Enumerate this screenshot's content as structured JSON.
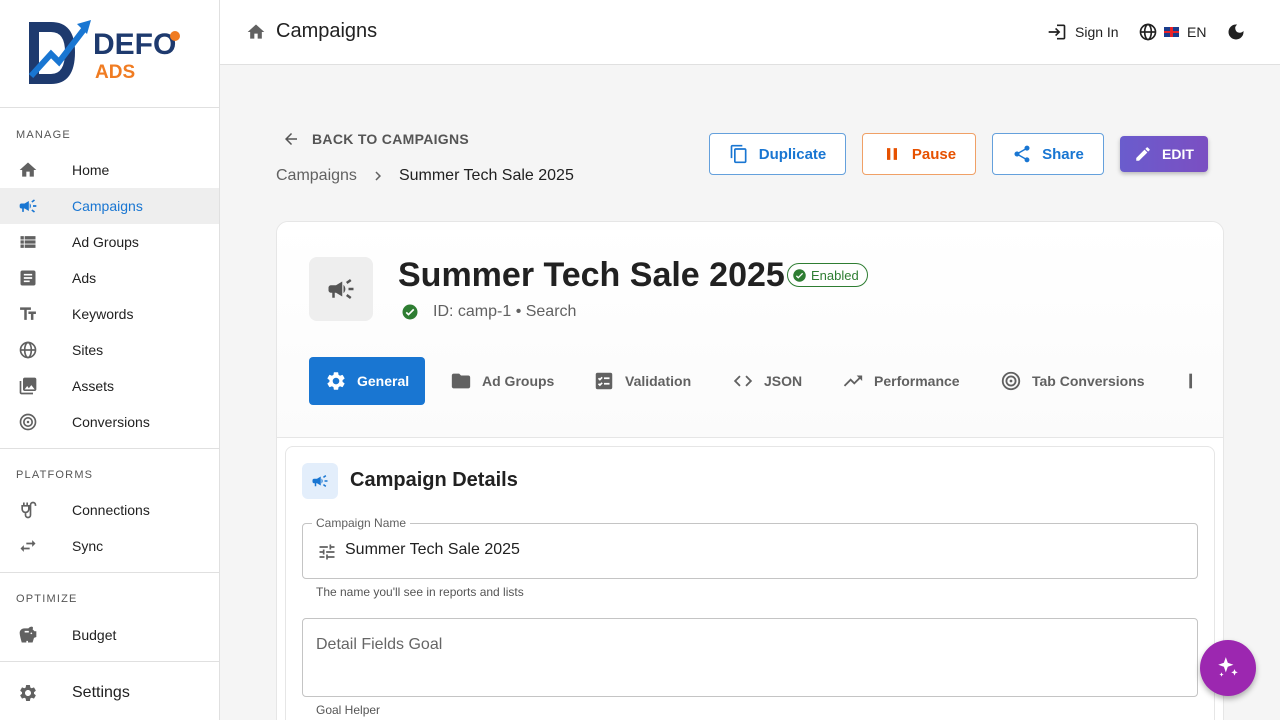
{
  "brand": {
    "line1": "DEFO",
    "line2": "ADS",
    "accent": "#1976d2",
    "orange": "#f07c22",
    "navy": "#1e3a6e"
  },
  "sidebar": {
    "sections": [
      {
        "label": "MANAGE",
        "items": [
          {
            "label": "Home",
            "icon": "home-icon"
          },
          {
            "label": "Campaigns",
            "icon": "megaphone-icon",
            "active": true
          },
          {
            "label": "Ad Groups",
            "icon": "list-icon"
          },
          {
            "label": "Ads",
            "icon": "article-icon"
          },
          {
            "label": "Keywords",
            "icon": "text-fields-icon"
          },
          {
            "label": "Sites",
            "icon": "globe-icon"
          },
          {
            "label": "Assets",
            "icon": "image-icon"
          },
          {
            "label": "Conversions",
            "icon": "target-icon"
          }
        ]
      },
      {
        "label": "PLATFORMS",
        "items": [
          {
            "label": "Connections",
            "icon": "plug-icon"
          },
          {
            "label": "Sync",
            "icon": "sync-arrows-icon"
          }
        ]
      },
      {
        "label": "OPTIMIZE",
        "items": [
          {
            "label": "Budget",
            "icon": "piggy-bank-icon"
          }
        ]
      }
    ],
    "settings": "Settings"
  },
  "topbar": {
    "title": "Campaigns",
    "sign_in": "Sign In",
    "language": "EN"
  },
  "header": {
    "back": "BACK TO CAMPAIGNS",
    "breadcrumb": [
      "Campaigns",
      "Summer Tech Sale 2025"
    ],
    "actions": {
      "duplicate": "Duplicate",
      "pause": "Pause",
      "share": "Share",
      "edit": "EDIT"
    }
  },
  "campaign": {
    "name": "Summer Tech Sale 2025",
    "status": "Enabled",
    "meta": "ID: camp-1 • Search",
    "status_color": "#2e7d32"
  },
  "tabs": [
    {
      "label": "General",
      "icon": "gear-icon",
      "active": true
    },
    {
      "label": "Ad Groups",
      "icon": "folder-icon"
    },
    {
      "label": "Validation",
      "icon": "checklist-icon"
    },
    {
      "label": "JSON",
      "icon": "code-icon"
    },
    {
      "label": "Performance",
      "icon": "trending-up-icon"
    },
    {
      "label": "Tab Conversions",
      "icon": "target-icon"
    }
  ],
  "details": {
    "title": "Campaign Details",
    "name_field": {
      "label": "Campaign Name",
      "value": "Summer Tech Sale 2025",
      "helper": "The name you'll see in reports and lists"
    },
    "goal_field": {
      "placeholder": "Detail Fields Goal",
      "helper": "Goal Helper"
    }
  }
}
